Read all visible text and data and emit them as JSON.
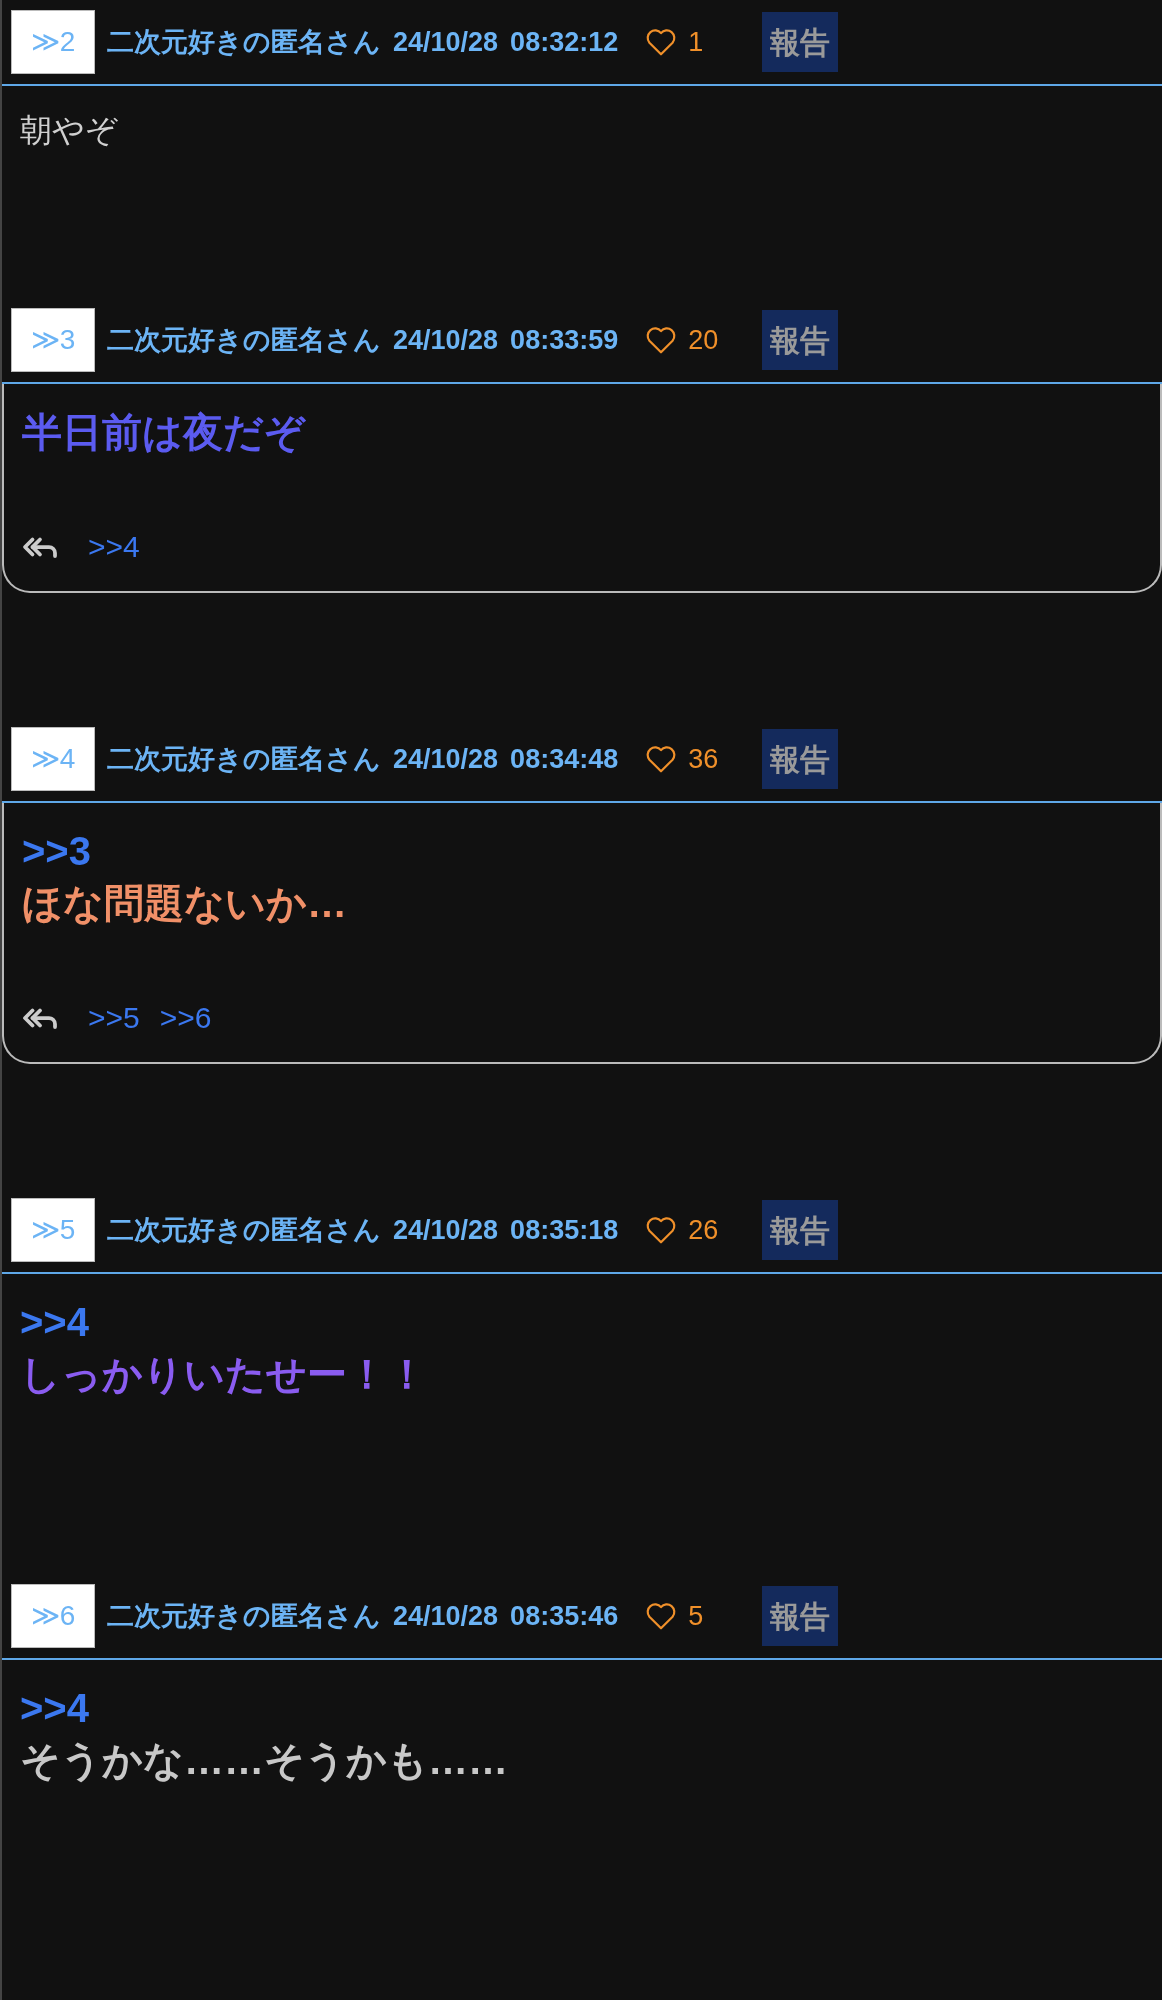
{
  "posts": [
    {
      "number": "≫2",
      "name": "二次元好きの匿名さん",
      "date": "24/10/28",
      "time": "08:32:12",
      "likes": "1",
      "report": "報告",
      "body": {
        "kind": "plain",
        "color": "#d0d0d0",
        "text": "朝やぞ"
      }
    },
    {
      "number": "≫3",
      "name": "二次元好きの匿名さん",
      "date": "24/10/28",
      "time": "08:33:59",
      "likes": "20",
      "report": "報告",
      "body": {
        "kind": "bold",
        "color": "#5b5bf0",
        "text": "半日前は夜だぞ"
      },
      "replies": [
        ">>4"
      ]
    },
    {
      "number": "≫4",
      "name": "二次元好きの匿名さん",
      "date": "24/10/28",
      "time": "08:34:48",
      "likes": "36",
      "report": "報告",
      "body": {
        "kind": "bold",
        "color": "#f09068",
        "anchor": ">>3",
        "text": "ほな問題ないか…"
      },
      "replies": [
        ">>5",
        ">>6"
      ]
    },
    {
      "number": "≫5",
      "name": "二次元好きの匿名さん",
      "date": "24/10/28",
      "time": "08:35:18",
      "likes": "26",
      "report": "報告",
      "body": {
        "kind": "bold",
        "color": "#8a5cf0",
        "anchor": ">>4",
        "text": "しっかりいたせー！！"
      }
    },
    {
      "number": "≫6",
      "name": "二次元好きの匿名さん",
      "date": "24/10/28",
      "time": "08:35:46",
      "likes": "5",
      "report": "報告",
      "body": {
        "kind": "bold",
        "color": "#c8c8c8",
        "anchor": ">>4",
        "text": "そうかな……そうかも……"
      }
    }
  ]
}
